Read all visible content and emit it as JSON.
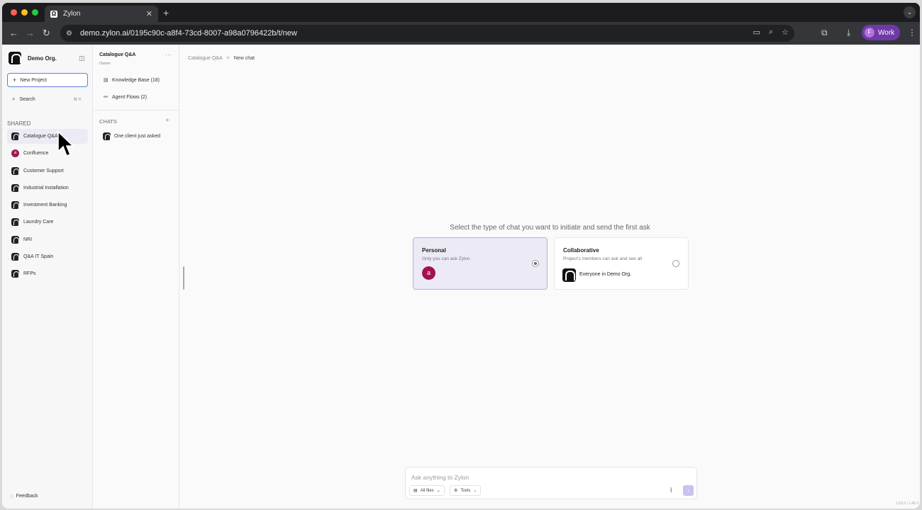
{
  "browser": {
    "tab_title": "Zylon",
    "tab_favicon": "Ω",
    "new_tab_icon": "+",
    "tab_close_icon": "✕",
    "url": "demo.zylon.ai/0195c90c-a8f4-73cd-8007-a98a0796422b/t/new",
    "profile_label": "Work",
    "profile_initial": "F"
  },
  "sidebar": {
    "org_name": "Demo Org.",
    "new_project_label": "New Project",
    "search_label": "Search",
    "search_shortcut": "⌘ K",
    "section_label": "SHARED",
    "projects": [
      {
        "label": "Catalogue Q&A",
        "active": true
      },
      {
        "label": "Confluence",
        "active": false
      },
      {
        "label": "Customer Support",
        "active": false
      },
      {
        "label": "Industrial Installation",
        "active": false
      },
      {
        "label": "Investment Banking",
        "active": false
      },
      {
        "label": "Laundry Care",
        "active": false
      },
      {
        "label": "NRI",
        "active": false
      },
      {
        "label": "Q&A IT Spain",
        "active": false
      },
      {
        "label": "RFPs",
        "active": false
      }
    ],
    "feedback_label": "Feedback"
  },
  "project_panel": {
    "title": "Catalogue Q&A",
    "role": "Owner",
    "more_icon": "···",
    "knowledge_base_label": "Knowledge Base (18)",
    "agent_flows_label": "Agent Flows (2)",
    "chats_label": "CHATS",
    "chats_add_icon": "+",
    "chats": [
      {
        "label": "One client just asked"
      }
    ]
  },
  "main": {
    "breadcrumb": {
      "parent": "Catalogue Q&A",
      "separator": ">",
      "current": "New chat"
    },
    "prompt": "Select the type of chat you want to initiate and send the first ask",
    "personal_card": {
      "title": "Personal",
      "subtitle": "Only you can ask Zylon",
      "avatar_initial": "a",
      "selected": true
    },
    "collab_card": {
      "title": "Collaborative",
      "subtitle": "Project's members can ask and see all",
      "team_label": "Everyone in Demo Org.",
      "selected": false
    },
    "composer": {
      "placeholder": "Ask anything to Zylon",
      "files_label": "All files",
      "tools_label": "Tools"
    },
    "version": "1.63.3 / 1.46.2"
  },
  "colors": {
    "accent": "#b7aee6",
    "accent_bg": "#eceaf5",
    "avatar": "#a3124e",
    "profile": "#6f3aa8"
  }
}
